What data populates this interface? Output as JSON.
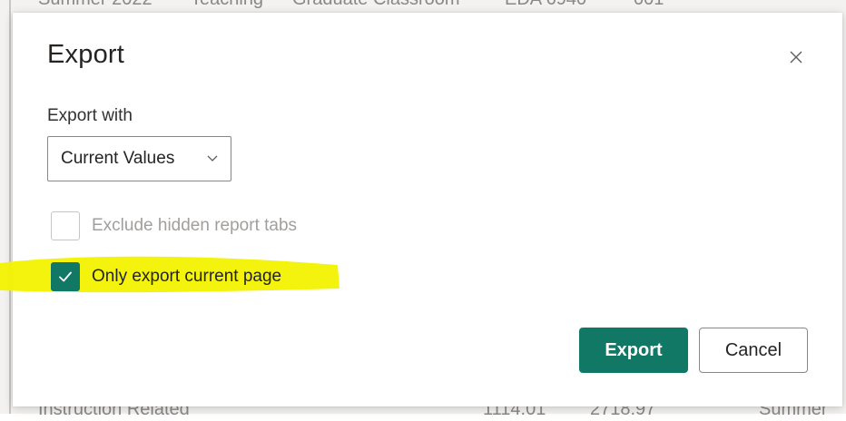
{
  "background": {
    "top_row": [
      "Summer 2022",
      "Teaching",
      "Graduate Classroom",
      "EDA 6940",
      "001"
    ],
    "bottom_row": [
      "Instruction Related",
      "1114.01",
      "2718.97",
      "Summer"
    ]
  },
  "dialog": {
    "title": "Export",
    "close_icon": "close-icon",
    "export_with_label": "Export with",
    "export_with_value": "Current Values",
    "options": [
      {
        "label": "Exclude hidden report tabs",
        "checked": false,
        "disabled": true
      },
      {
        "label": "Only export current page",
        "checked": true,
        "disabled": false
      }
    ],
    "primary_button": "Export",
    "secondary_button": "Cancel"
  },
  "colors": {
    "accent": "#117865",
    "highlight": "#f2f200"
  }
}
